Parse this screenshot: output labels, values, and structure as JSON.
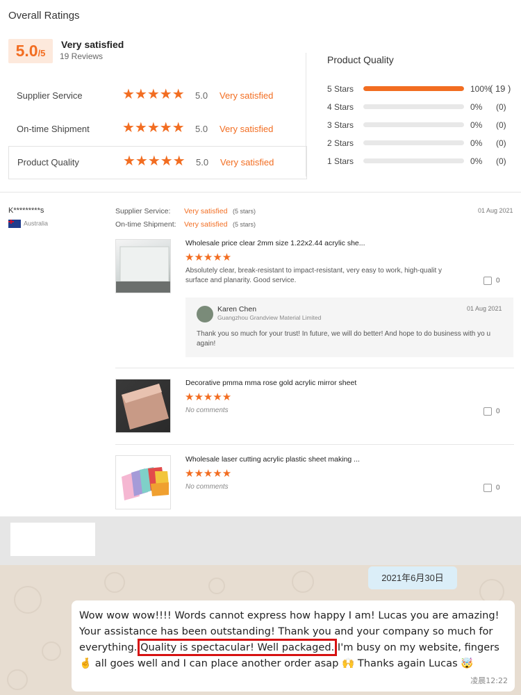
{
  "overall": {
    "title": "Overall Ratings",
    "score": "5.0",
    "out_of": "/5",
    "label": "Very satisfied",
    "reviews": "19 Reviews"
  },
  "ratings": [
    {
      "label": "Supplier Service",
      "stars": "★★★★★",
      "score": "5.0",
      "text": "Very satisfied"
    },
    {
      "label": "On-time Shipment",
      "stars": "★★★★★",
      "score": "5.0",
      "text": "Very satisfied"
    },
    {
      "label": "Product Quality",
      "stars": "★★★★★",
      "score": "5.0",
      "text": "Very satisfied"
    }
  ],
  "product_quality": {
    "title": "Product Quality",
    "rows": [
      {
        "label": "5 Stars",
        "pct": "100%",
        "count": "( 19 )",
        "fraction": 1.0
      },
      {
        "label": "4 Stars",
        "pct": "0%",
        "count": "(0)",
        "fraction": 0
      },
      {
        "label": "3 Stars",
        "pct": "0%",
        "count": "(0)",
        "fraction": 0
      },
      {
        "label": "2 Stars",
        "pct": "0%",
        "count": "(0)",
        "fraction": 0
      },
      {
        "label": "1 Stars",
        "pct": "0%",
        "count": "(0)",
        "fraction": 0
      }
    ]
  },
  "review": {
    "reviewer": "K*********s",
    "country": "Australia",
    "date": "01 Aug 2021",
    "supplier_label": "Supplier Service:",
    "supplier_value": "Very satisfied",
    "supplier_stars": "(5 stars)",
    "shipment_label": "On-time Shipment:",
    "shipment_value": "Very satisfied",
    "shipment_stars": "(5 stars)",
    "products": [
      {
        "title": "Wholesale price clear 2mm size 1.22x2.44 acrylic she...",
        "stars": "★★★★★",
        "comment": "Absolutely clear, break-resistant to impact-resistant, very easy to work, high-qualit y surface and planarity. Good service.",
        "likes": "0"
      },
      {
        "title": "Decorative pmma mma rose gold acrylic mirror sheet",
        "stars": "★★★★★",
        "comment": "No comments",
        "likes": "0"
      },
      {
        "title": "Wholesale laser cutting acrylic plastic sheet making ...",
        "stars": "★★★★★",
        "comment": "No comments",
        "likes": "0"
      }
    ],
    "reply": {
      "name": "Karen Chen",
      "company": "Guangzhou Grandview Material Limited",
      "date": "01 Aug 2021",
      "message": "Thank you so much for your trust! In future, we will do better! And hope to do business with yo u again!"
    }
  },
  "chat": {
    "date": "2021年6月30日",
    "msg_part1": "Wow wow wow!!!! Words cannot express how happy I am! Lucas you are amazing! Your assistance has been outstanding! Thank you and your company so much for everything.",
    "msg_highlight": "Quality is spectacular! Well packaged.",
    "msg_part2": "I'm busy on my website, fingers 🤞 all goes well and I can place another order asap 🙌 Thanks again Lucas 🤯",
    "time": "凌晨12:22"
  }
}
